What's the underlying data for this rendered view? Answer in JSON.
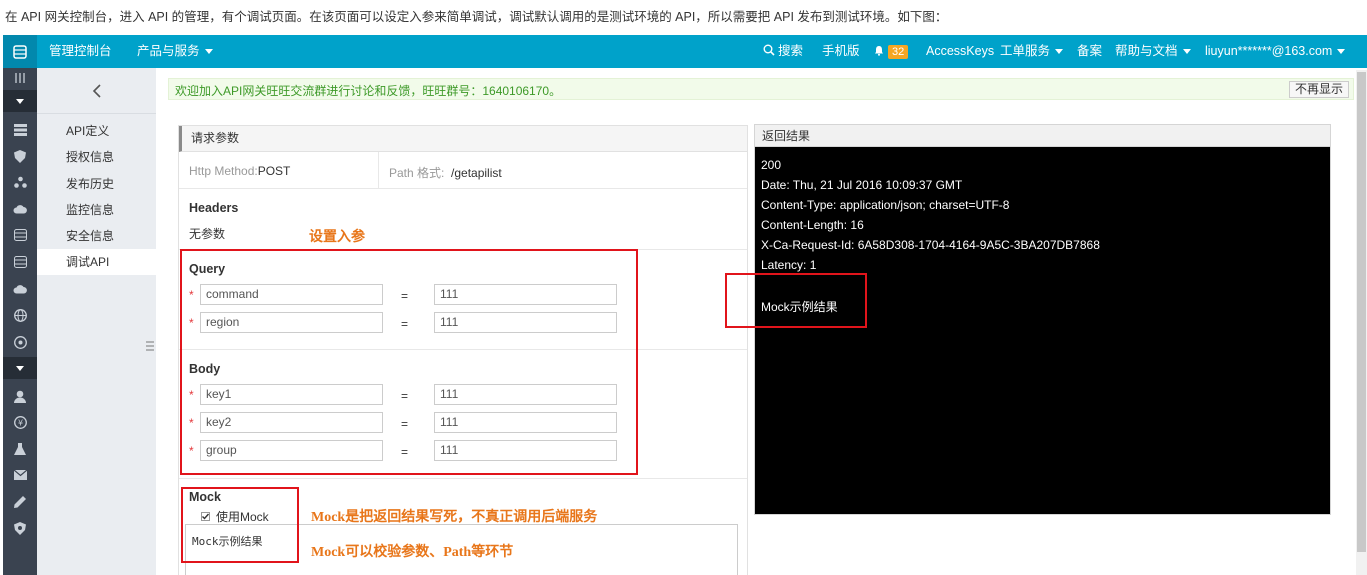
{
  "intro_text": "在 API 网关控制台，进入 API 的管理，有个调试页面。在该页面可以设定入参来简单调试，调试默认调用的是测试环境的 API，所以需要把 API 发布到测试环境。如下图：",
  "navbar": {
    "console": "管理控制台",
    "products": "产品与服务",
    "search": "搜索",
    "mobile": "手机版",
    "notif_count": "32",
    "access_keys": "AccessKeys",
    "tickets": "工单服务",
    "beian": "备案",
    "help": "帮助与文档",
    "user": "liuyun*******@163.com"
  },
  "sidebar": {
    "items": [
      {
        "label": "API定义"
      },
      {
        "label": "授权信息"
      },
      {
        "label": "发布历史"
      },
      {
        "label": "监控信息"
      },
      {
        "label": "安全信息"
      },
      {
        "label": "调试API"
      }
    ],
    "active_index": 5
  },
  "notice": {
    "text": "欢迎加入API网关旺旺交流群进行讨论和反馈，旺旺群号：1640106170。",
    "dismiss": "不再显示"
  },
  "request": {
    "title": "请求参数",
    "method_label": "Http Method:",
    "method_value": "POST",
    "path_label": "Path 格式:",
    "path_value": "/getapilist",
    "headers_title": "Headers",
    "headers_empty": "无参数",
    "query_title": "Query",
    "query_params": [
      {
        "name": "command",
        "value": "111"
      },
      {
        "name": "region",
        "value": "111"
      }
    ],
    "body_title": "Body",
    "body_params": [
      {
        "name": "key1",
        "value": "111"
      },
      {
        "name": "key2",
        "value": "111"
      },
      {
        "name": "group",
        "value": "111"
      }
    ],
    "eq": "=",
    "mock_title": "Mock",
    "mock_checkbox_label": "使用Mock",
    "mock_checked": true,
    "mock_text": "Mock示例结果"
  },
  "response": {
    "title": "返回结果",
    "lines": [
      "200",
      "Date: Thu, 21 Jul 2016 10:09:37 GMT",
      "Content-Type: application/json; charset=UTF-8",
      "Content-Length: 16",
      "X-Ca-Request-Id: 6A58D308-1704-4164-9A5C-3BA207DB7868",
      "Latency: 1"
    ],
    "body": "Mock示例结果"
  },
  "annotations": {
    "set_params": "设置入参",
    "mock_note1": "Mock是把返回结果写死，不真正调用后端服务",
    "mock_note2": "Mock可以校验参数、Path等环节"
  },
  "colors": {
    "navbar": "#00a2ca",
    "rail": "#3a4350",
    "annotation_red": "#e1141b",
    "annotation_orange": "#e8761a"
  }
}
